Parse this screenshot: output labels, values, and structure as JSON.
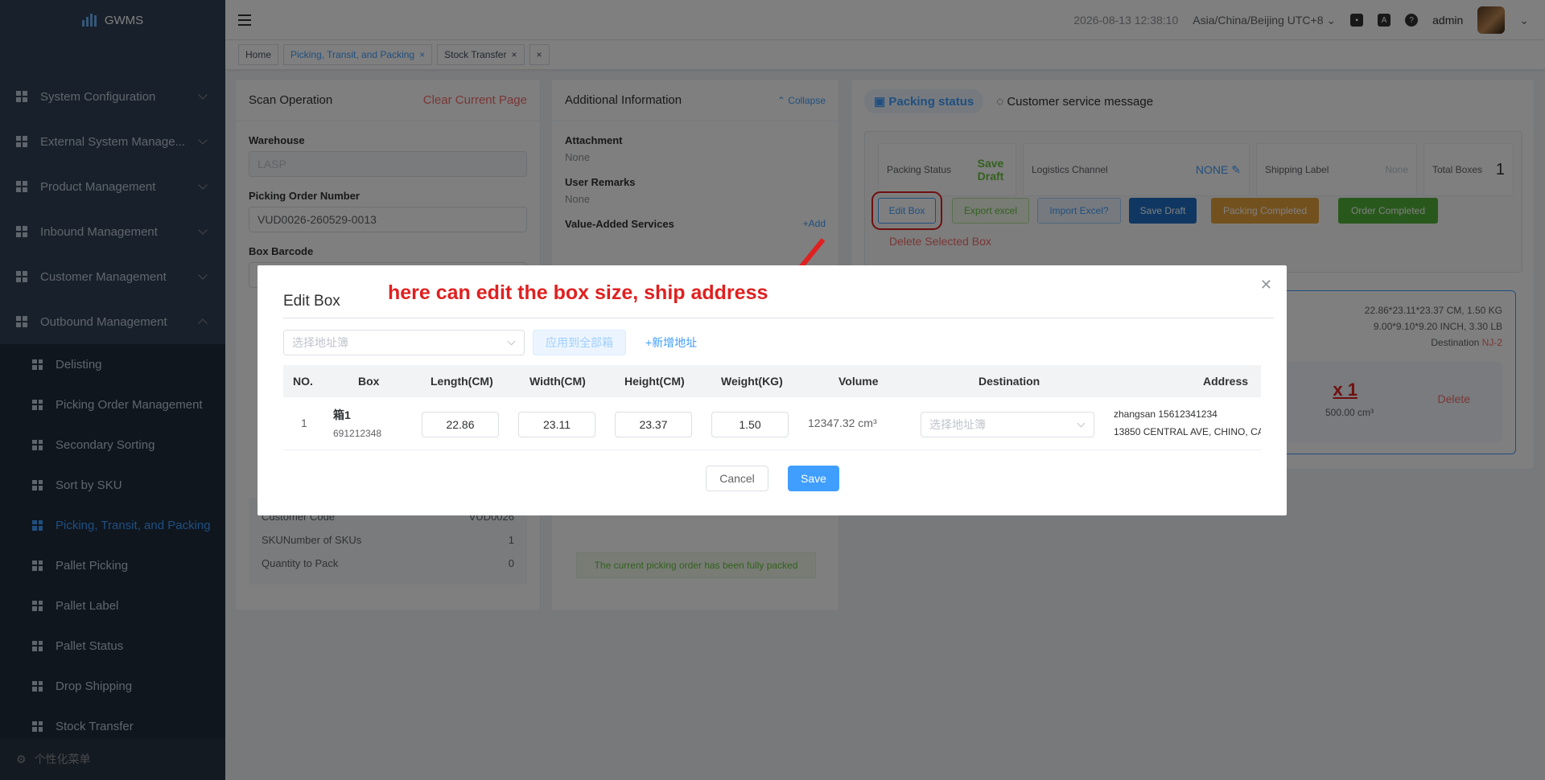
{
  "app": {
    "name": "GWMS"
  },
  "sidebar": {
    "items": [
      {
        "label": "System Configuration"
      },
      {
        "label": "External System Manage..."
      },
      {
        "label": "Product Management"
      },
      {
        "label": "Inbound Management"
      },
      {
        "label": "Customer Management"
      },
      {
        "label": "Outbound Management"
      }
    ],
    "subitems": [
      {
        "label": "Delisting"
      },
      {
        "label": "Picking Order Management"
      },
      {
        "label": "Secondary Sorting"
      },
      {
        "label": "Sort by SKU"
      },
      {
        "label": "Picking, Transit, and Packing"
      },
      {
        "label": "Pallet Picking"
      },
      {
        "label": "Pallet Label"
      },
      {
        "label": "Pallet Status"
      },
      {
        "label": "Drop Shipping"
      },
      {
        "label": "Stock Transfer"
      }
    ],
    "footer": "个性化菜单"
  },
  "header": {
    "datetime": "2026-08-13 12:38:10",
    "timezone": "Asia/China/Beijing UTC+8",
    "user": "admin"
  },
  "tags": [
    {
      "label": "Home"
    },
    {
      "label": "Picking, Transit, and Packing"
    },
    {
      "label": "Stock Transfer"
    }
  ],
  "scan": {
    "title": "Scan Operation",
    "clear": "Clear Current Page",
    "warehouse_label": "Warehouse",
    "warehouse_placeholder": "LASP",
    "order_label": "Picking Order Number",
    "order_value": "VUD0026-260529-0013",
    "barcode_label": "Box Barcode",
    "info": [
      {
        "k": "Customer Code",
        "v": "VUD0026"
      },
      {
        "k": "SKUNumber of SKUs",
        "v": "1"
      },
      {
        "k": "Quantity to Pack",
        "v": "0"
      }
    ]
  },
  "additional": {
    "title": "Additional Information",
    "collapse": "Collapse",
    "attachment_label": "Attachment",
    "attachment_value": "None",
    "remarks_label": "User Remarks",
    "remarks_value": "None",
    "vas_label": "Value-Added Services",
    "vas_add": "+Add",
    "packed_msg": "The current picking order has been fully packed"
  },
  "status_panel": {
    "tab_packing": "Packing status",
    "tab_service": "Customer service message",
    "packing_status_label": "Packing Status",
    "packing_status_value": "Save Draft",
    "logistics_label": "Logistics Channel",
    "logistics_value": "NONE",
    "shipping_label": "Shipping Label",
    "shipping_value": "None",
    "total_boxes_label": "Total Boxes",
    "total_boxes_value": "1",
    "buttons": {
      "edit_box": "Edit Box",
      "export": "Export excel",
      "import": "Import Excel?",
      "save_draft": "Save Draft",
      "packing_completed": "Packing Completed",
      "order_completed": "Order Completed",
      "delete_selected": "Delete Selected Box"
    },
    "box_card": {
      "dims_cm": "22.86*23.11*23.37 CM, 1.50 KG",
      "dims_inch": "9.00*9.10*9.20 INCH, 3.30 LB",
      "destination_label": "Destination",
      "destination_value": "NJ-2",
      "qty": "x 1",
      "volume": "500.00 cm³",
      "delete": "Delete"
    }
  },
  "dialog": {
    "title": "Edit Box",
    "annotation": "here can edit the box size, ship address",
    "address_book_placeholder": "选择地址簿",
    "apply_all": "应用到全部箱",
    "new_address": "+新增地址",
    "columns": [
      "NO.",
      "Box",
      "Length(CM)",
      "Width(CM)",
      "Height(CM)",
      "Weight(KG)",
      "Volume",
      "Destination",
      "Address"
    ],
    "rows": [
      {
        "no": "1",
        "box_name": "箱1",
        "box_code": "691212348",
        "length": "22.86",
        "width": "23.11",
        "height": "23.37",
        "weight": "1.50",
        "volume": "12347.32 cm³",
        "destination_placeholder": "选择地址簿",
        "address_line1": "zhangsan 15612341234",
        "address_line2": "13850 CENTRAL AVE, CHINO, CA"
      }
    ],
    "cancel": "Cancel",
    "save": "Save"
  },
  "colors": {
    "primary": "#409eff",
    "danger": "#f56c6c",
    "success": "#67c23a",
    "warning": "#e6a23c",
    "sidebar_bg": "#304156",
    "annotation_red": "#e02020"
  }
}
